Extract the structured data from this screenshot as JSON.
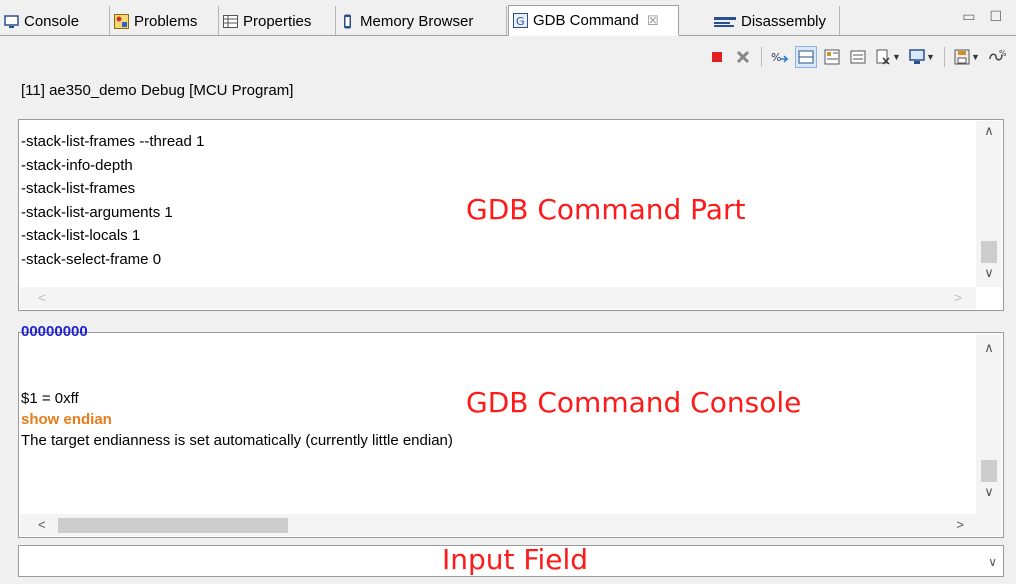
{
  "tabs": [
    {
      "label": "Console",
      "icon": "console-icon"
    },
    {
      "label": "Problems",
      "icon": "problems-icon"
    },
    {
      "label": "Properties",
      "icon": "properties-icon"
    },
    {
      "label": "Memory Browser",
      "icon": "memory-icon"
    },
    {
      "label": "GDB Command",
      "icon": "gdb-icon",
      "active": true,
      "close": "☒"
    },
    {
      "label": "Disassembly",
      "icon": "disassembly-icon"
    }
  ],
  "window_buttons": {
    "minimize": "▭",
    "maximize": "☐"
  },
  "toolbar_icons": [
    "terminate-icon",
    "remove-icon",
    "connect-icon",
    "layout-icon",
    "registers-icon",
    "view-icon",
    "clear-icon",
    "display-icon",
    "save-icon",
    "link-icon"
  ],
  "session_label": "[11] ae350_demo Debug [MCU Program]",
  "command_part": {
    "lines": [
      "-stack-list-frames --thread 1",
      "-stack-info-depth",
      "-stack-list-frames",
      "-stack-list-arguments 1",
      "-stack-list-locals 1",
      "-stack-select-frame 0"
    ],
    "overlay_label": "GDB Command Part"
  },
  "command_console": {
    "truncated_line": "00000000",
    "result_line": "$1 = 0xff",
    "command_line": "show endian",
    "output_line": "The target endianness is set automatically (currently little endian)",
    "overlay_label": "GDB Command Console"
  },
  "input_field": {
    "overlay_label": "Input Field",
    "value": ""
  },
  "colors": {
    "overlay": "#ff1a1a",
    "command": "#e87b1a",
    "truncated": "#1f1fcf",
    "accent": "#dbe8f7"
  }
}
